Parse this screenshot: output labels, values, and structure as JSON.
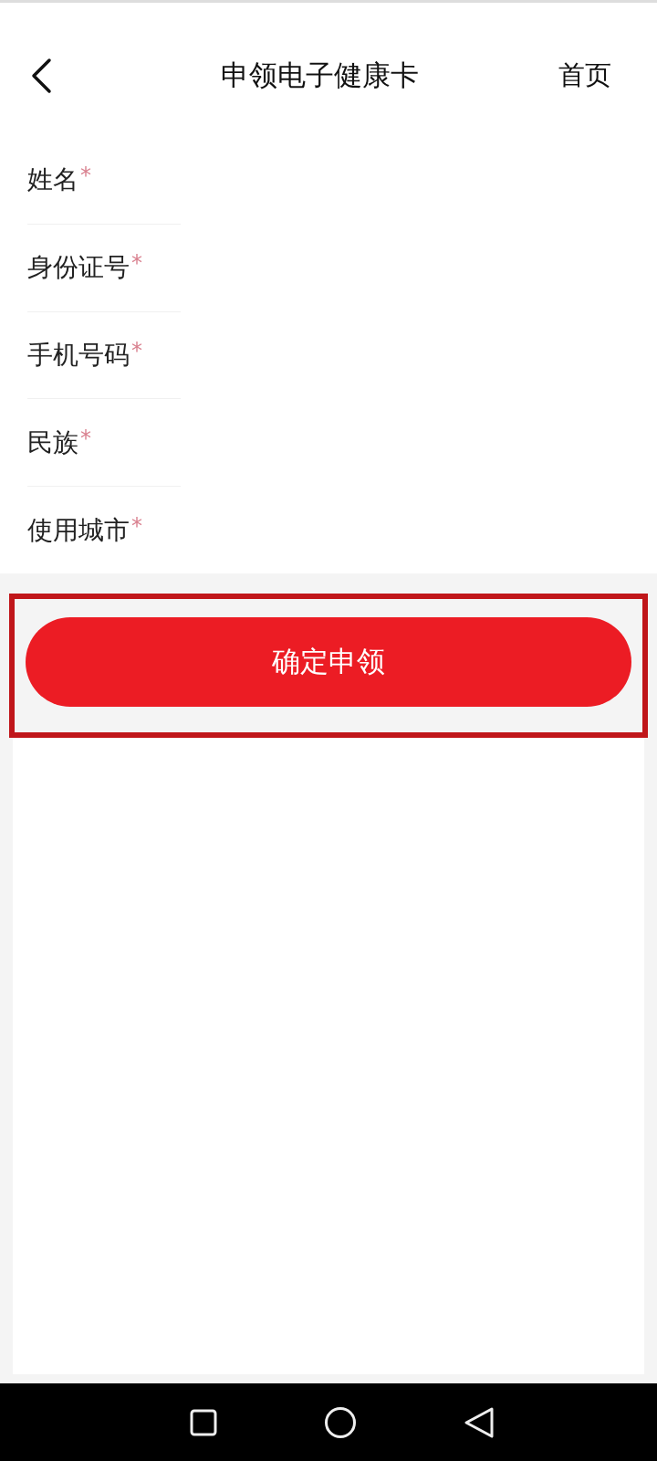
{
  "header": {
    "title": "申领电子健康卡",
    "home_link": "首页"
  },
  "fields": [
    {
      "label": "姓名",
      "marker": "*"
    },
    {
      "label": "身份证号",
      "marker": "*"
    },
    {
      "label": "手机号码",
      "marker": "*"
    },
    {
      "label": "民族",
      "marker": "*"
    },
    {
      "label": "使用城市",
      "marker": "*"
    }
  ],
  "submit_button": {
    "label": "确定申领",
    "highlighted": true
  }
}
